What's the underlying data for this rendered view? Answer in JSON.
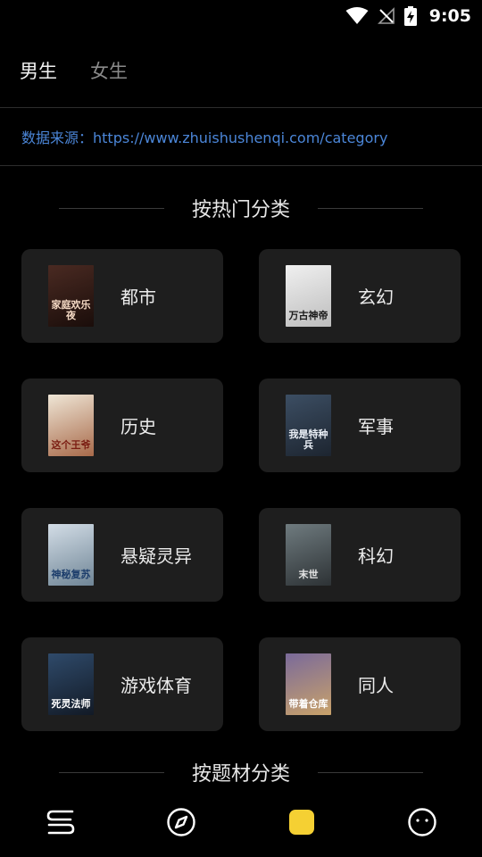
{
  "status_bar": {
    "time": "9:05",
    "icons": [
      "wifi-icon",
      "signal-off-icon",
      "battery-charging-icon"
    ]
  },
  "gender_tabs": [
    {
      "label": "男生",
      "active": true
    },
    {
      "label": "女生",
      "active": false
    }
  ],
  "source": {
    "prefix": "数据来源：",
    "url": "https://www.zhuishushenqi.com/category"
  },
  "sections": {
    "hot": {
      "title": "按热门分类"
    },
    "theme": {
      "title": "按题材分类"
    }
  },
  "categories": [
    {
      "label": "都市",
      "cover_text": "家庭欢乐夜",
      "cover_colors": [
        "#4a2a22",
        "#1a0d0a"
      ],
      "cover_text_color": "#f4d9c4"
    },
    {
      "label": "玄幻",
      "cover_text": "万古神帝",
      "cover_colors": [
        "#f0f0f0",
        "#bdbdbd"
      ],
      "cover_text_color": "#1a1a1a"
    },
    {
      "label": "历史",
      "cover_text": "这个王爷",
      "cover_colors": [
        "#efe6d6",
        "#a86a4a"
      ],
      "cover_text_color": "#7a1d12"
    },
    {
      "label": "军事",
      "cover_text": "我是特种兵",
      "cover_colors": [
        "#3c4e63",
        "#1d2530"
      ],
      "cover_text_color": "#e9eef5"
    },
    {
      "label": "悬疑灵异",
      "cover_text": "神秘复苏",
      "cover_colors": [
        "#d3dde6",
        "#6f8596"
      ],
      "cover_text_color": "#1c3d6b"
    },
    {
      "label": "科幻",
      "cover_text": "末世",
      "cover_colors": [
        "#6f7b7f",
        "#2d3235"
      ],
      "cover_text_color": "#e8e8e8"
    },
    {
      "label": "游戏体育",
      "cover_text": "死灵法师",
      "cover_colors": [
        "#2f4a6a",
        "#121a26"
      ],
      "cover_text_color": "#ffffff"
    },
    {
      "label": "同人",
      "cover_text": "带着仓库",
      "cover_colors": [
        "#7a6a9a",
        "#c9a26a"
      ],
      "cover_text_color": "#ffffff"
    }
  ],
  "bottom_nav": [
    {
      "icon": "bookshelf-icon",
      "active": false
    },
    {
      "icon": "compass-icon",
      "active": false
    },
    {
      "icon": "category-icon",
      "active": true
    },
    {
      "icon": "profile-face-icon",
      "active": false
    }
  ],
  "colors": {
    "accent": "#f5d033",
    "link": "#4b86d8",
    "card_bg": "#1e1e1e",
    "background": "#000000"
  }
}
